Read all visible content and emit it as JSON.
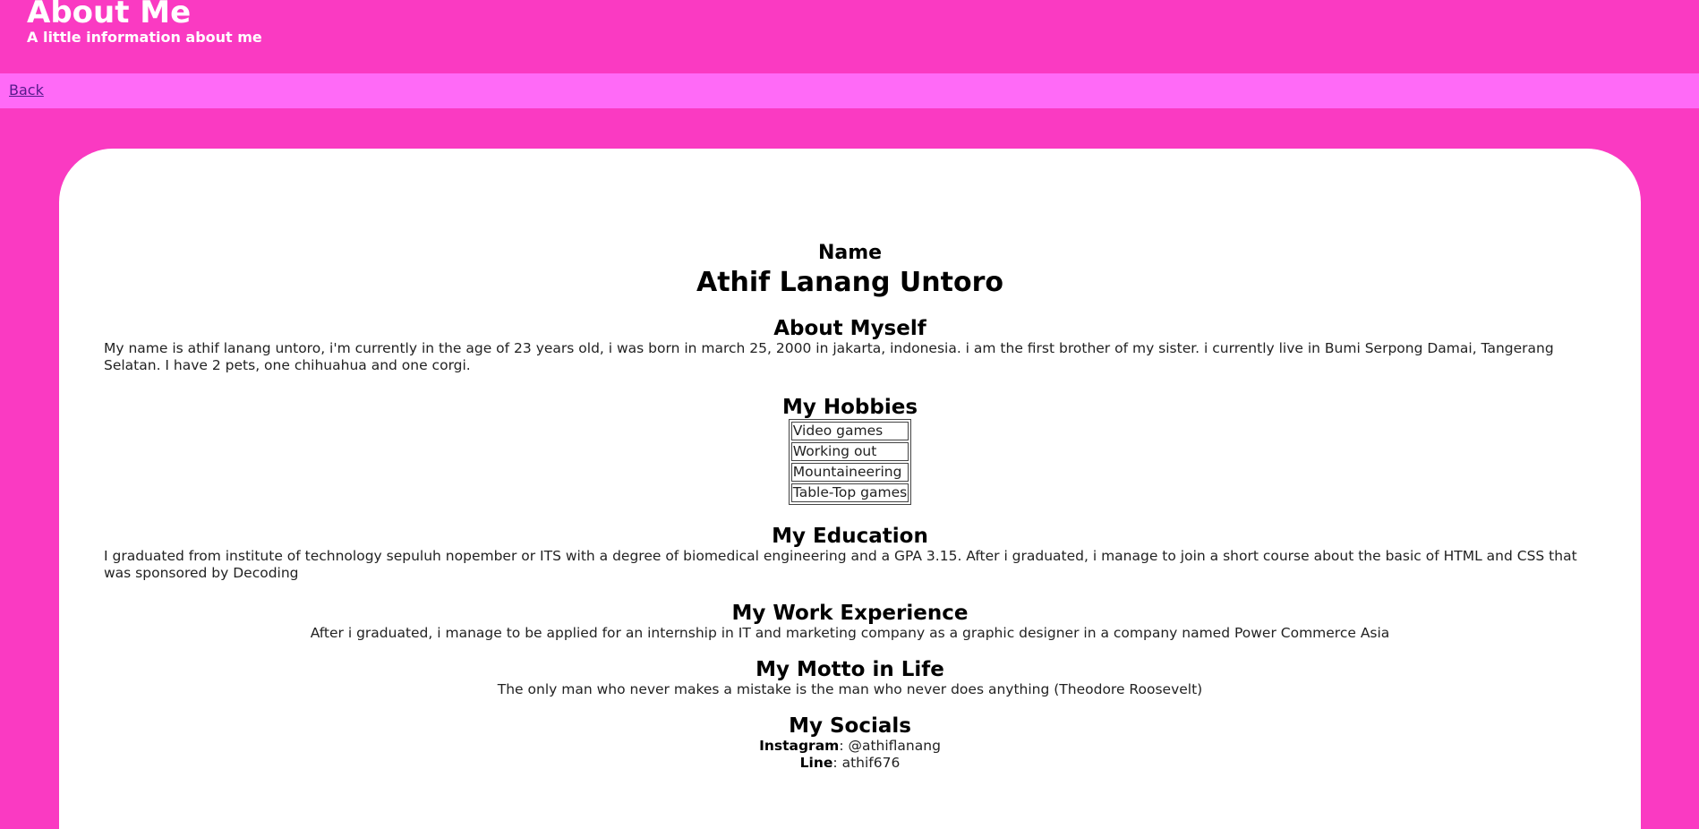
{
  "header": {
    "title": "About Me",
    "subtitle": "A little information about me"
  },
  "nav": {
    "back_label": "Back"
  },
  "name_section": {
    "label": "Name",
    "value": "Athif Lanang Untoro"
  },
  "about": {
    "title": "About Myself",
    "text": "My name is athif lanang untoro, i'm currently in the age of 23 years old, i was born in march 25, 2000 in jakarta, indonesia. i am the first brother of my sister. i currently live in Bumi Serpong Damai, Tangerang Selatan. I have 2 pets, one chihuahua and one corgi."
  },
  "hobbies": {
    "title": "My Hobbies",
    "items": [
      "Video games",
      "Working out",
      "Mountaineering",
      "Table-Top games"
    ]
  },
  "education": {
    "title": "My Education",
    "text": "I graduated from institute of technology sepuluh nopember or ITS with a degree of biomedical engineering and a GPA 3.15. After i graduated, i manage to join a short course about the basic of HTML and CSS that was sponsored by Decoding"
  },
  "work": {
    "title": "My Work Experience",
    "text": "After i graduated, i manage to be applied for an internship in IT and marketing company as a graphic designer in a company named Power Commerce Asia"
  },
  "motto": {
    "title": "My Motto in Life",
    "text": "The only man who never makes a mistake is the man who never does anything (Theodore Roosevelt)"
  },
  "socials": {
    "title": "My Socials",
    "instagram_label": "Instagram",
    "instagram_value": ": @athiflanang",
    "line_label": "Line",
    "line_value": ": athif676"
  },
  "colors": {
    "page_background": "#fa3ac2",
    "navbar_background": "#ff6af7",
    "card_background": "#ffffff",
    "link": "#551a8b"
  }
}
